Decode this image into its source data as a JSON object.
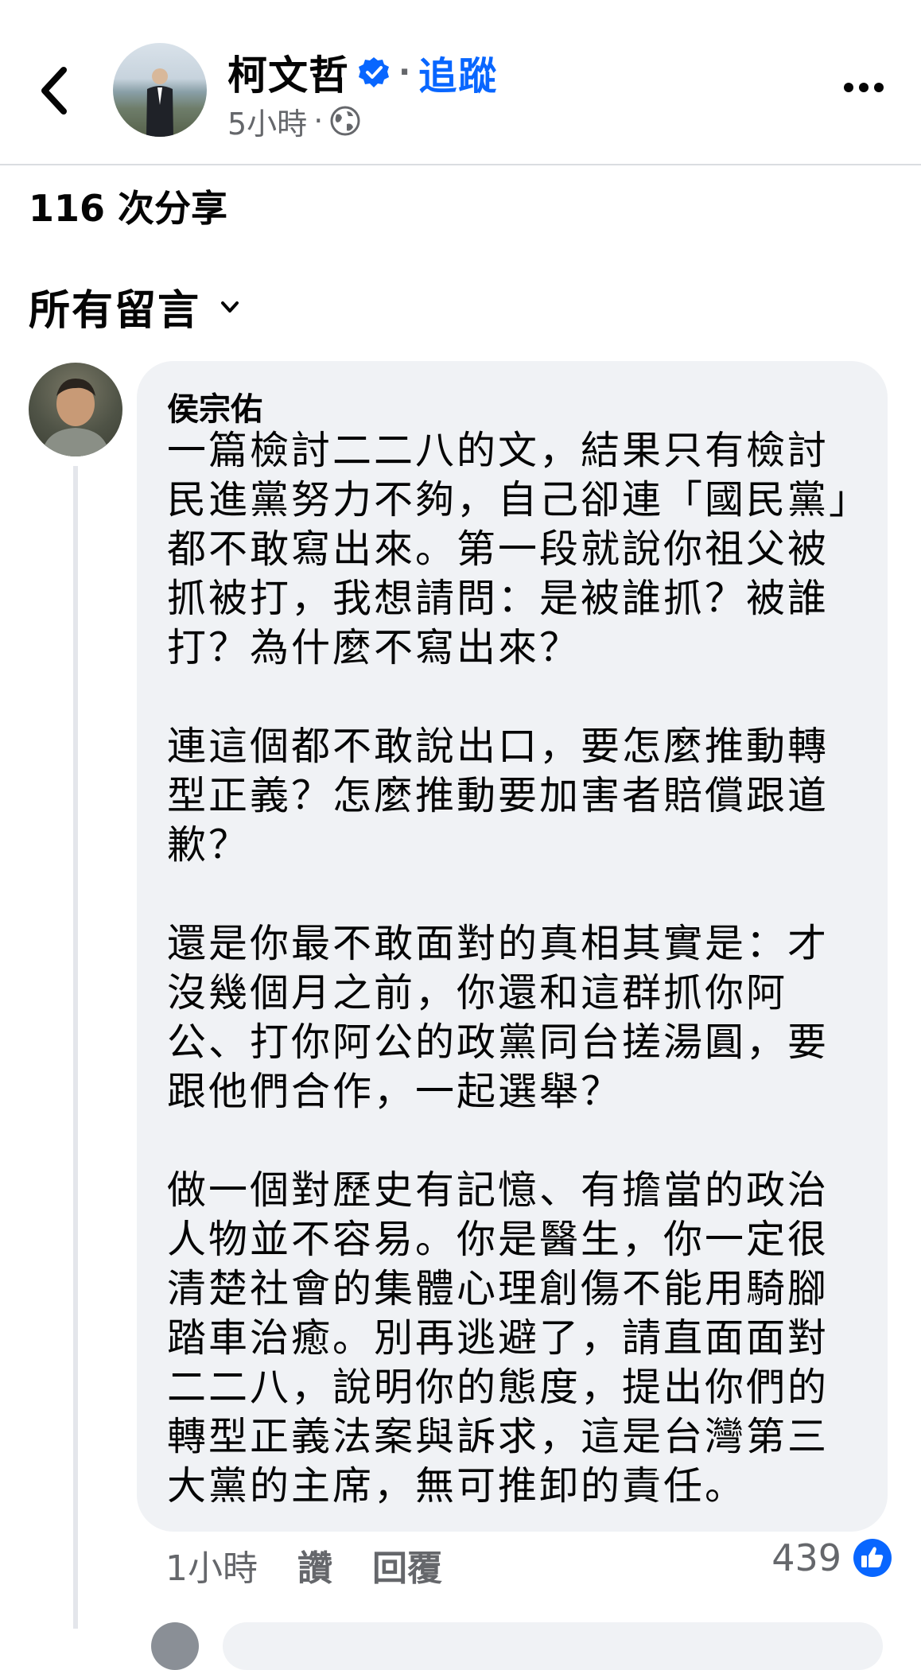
{
  "post": {
    "author": "柯文哲",
    "follow_label": "追蹤",
    "time": "5小時",
    "separator": "·"
  },
  "shares": "116 次分享",
  "comments_filter": "所有留言",
  "comment": {
    "author": "侯宗佑",
    "text": "一篇檢討二二八的文，結果只有檢討民進黨努力不夠，自己卻連「國民黨」都不敢寫出來。第一段就說你祖父被抓被打，我想請問：是被誰抓？被誰打？為什麼不寫出來？\n\n連這個都不敢說出口，要怎麼推動轉型正義？怎麼推動要加害者賠償跟道歉？\n\n還是你最不敢面對的真相其實是：才沒幾個月之前，你還和這群抓你阿公、打你阿公的政黨同台搓湯圓，要跟他們合作，一起選舉？\n\n做一個對歷史有記憶、有擔當的政治人物並不容易。你是醫生，你一定很清楚社會的集體心理創傷不能用騎腳踏車治癒。別再逃避了，請直面面對二二八，說明你的態度，提出你們的轉型正義法案與訴求，這是台灣第三大黨的主席，無可推卸的責任。",
    "time": "1小時",
    "like_label": "讚",
    "reply_label": "回覆",
    "reaction_count": "439"
  },
  "icons": {
    "back": "chevron-left-icon",
    "verified": "verified-badge-icon",
    "audience": "globe-icon",
    "more": "more-options-icon",
    "filter": "chevron-down-icon",
    "reaction": "thumbs-up-icon"
  },
  "colors": {
    "accent": "#0866ff",
    "muted": "#65676b",
    "bubble": "#f0f2f5"
  }
}
